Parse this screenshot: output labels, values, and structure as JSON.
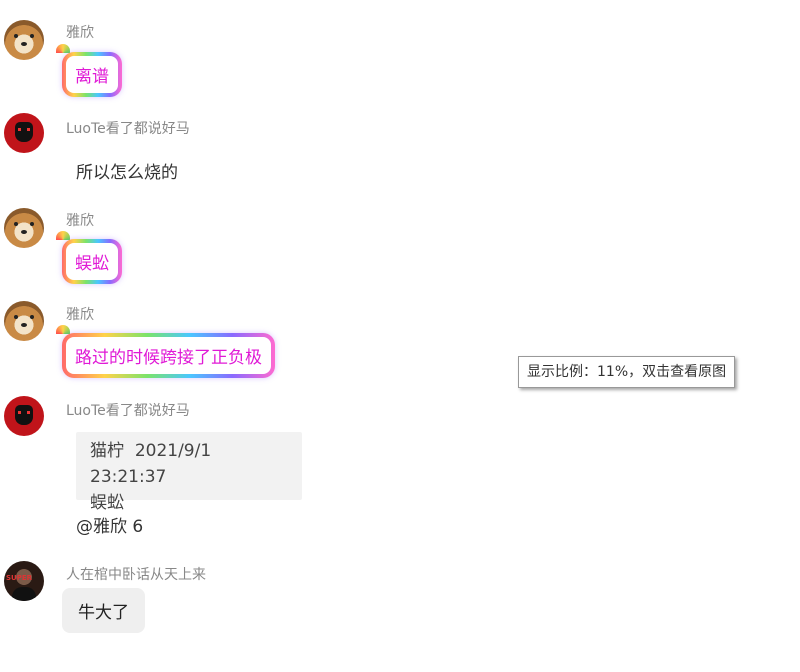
{
  "messages": [
    {
      "sender": "雅欣",
      "text": "离谱"
    },
    {
      "sender": "LuoTe看了都说好马",
      "text": "所以怎么烧的"
    },
    {
      "sender": "雅欣",
      "text": "蜈蚣"
    },
    {
      "sender": "雅欣",
      "text": "路过的时候跨接了正负极"
    },
    {
      "sender": "LuoTe看了都说好马",
      "quote": {
        "author": "猫柠",
        "time": "2021/9/1 23:21:37",
        "text": "蜈蚣"
      },
      "text": "@雅欣 6"
    },
    {
      "sender": "人在棺中卧话从天上来",
      "text": "牛大了"
    }
  ],
  "tooltip": {
    "text": "显示比例：11%，双击查看原图"
  },
  "colors": {
    "rainbow_text": "#e01ad6",
    "name_gray": "#888888",
    "quote_bg": "#f2f2f2"
  }
}
